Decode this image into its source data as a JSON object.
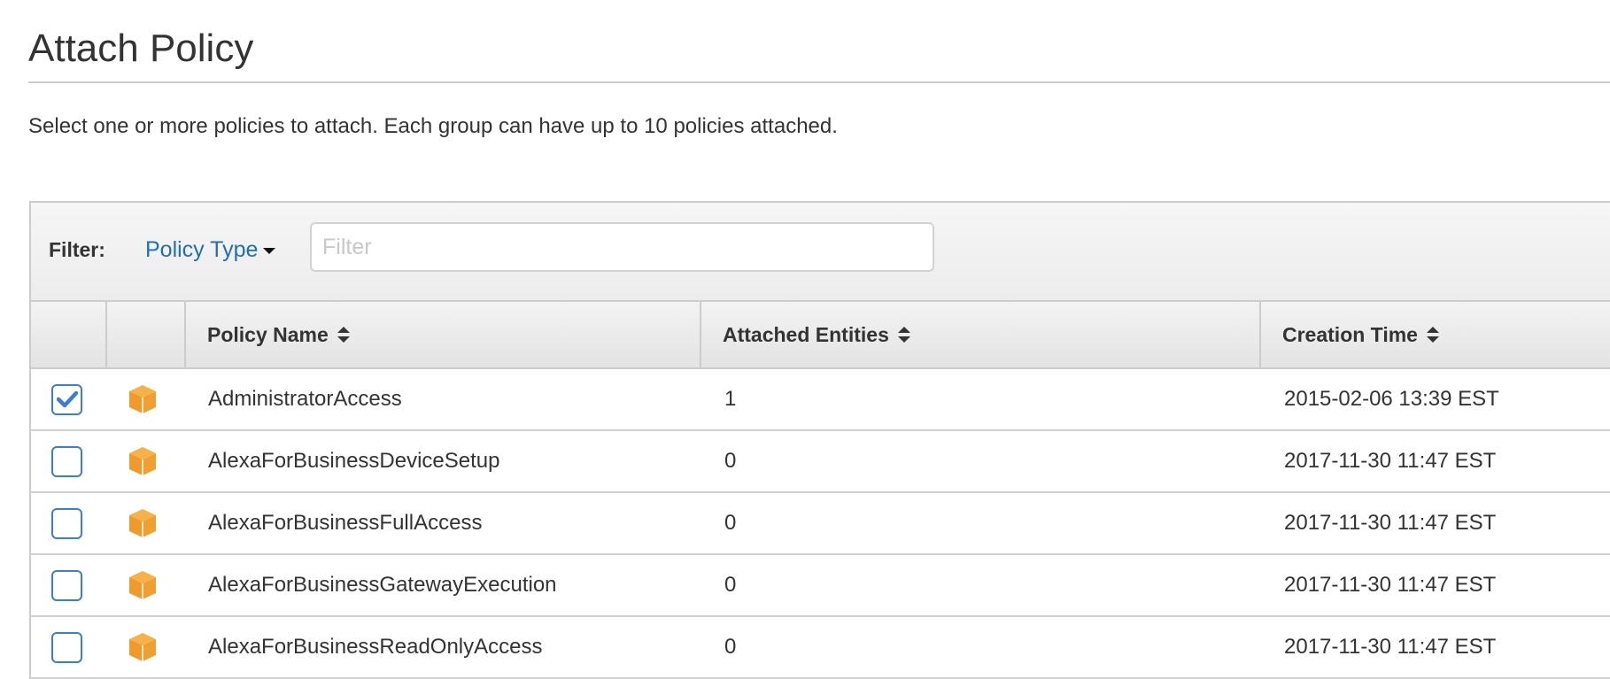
{
  "page": {
    "title": "Attach Policy",
    "subtitle": "Select one or more policies to attach. Each group can have up to 10 policies attached."
  },
  "filter": {
    "label": "Filter:",
    "policy_type_label": "Policy Type",
    "input_value": "",
    "input_placeholder": "Filter"
  },
  "columns": {
    "policy_name": "Policy Name",
    "attached_entities": "Attached Entities",
    "creation_time": "Creation Time"
  },
  "colors": {
    "accent": "#1f6fb8",
    "checkbox": "#3b7fd4",
    "policy_icon": "#f0a030"
  },
  "rows": [
    {
      "checked": true,
      "icon": "aws-managed-policy-cube-icon",
      "name": "AdministratorAccess",
      "entities": "1",
      "created": "2015-02-06 13:39 EST"
    },
    {
      "checked": false,
      "icon": "aws-managed-policy-cube-icon",
      "name": "AlexaForBusinessDeviceSetup",
      "entities": "0",
      "created": "2017-11-30 11:47 EST"
    },
    {
      "checked": false,
      "icon": "aws-managed-policy-cube-icon",
      "name": "AlexaForBusinessFullAccess",
      "entities": "0",
      "created": "2017-11-30 11:47 EST"
    },
    {
      "checked": false,
      "icon": "aws-managed-policy-cube-icon",
      "name": "AlexaForBusinessGatewayExecution",
      "entities": "0",
      "created": "2017-11-30 11:47 EST"
    },
    {
      "checked": false,
      "icon": "aws-managed-policy-cube-icon",
      "name": "AlexaForBusinessReadOnlyAccess",
      "entities": "0",
      "created": "2017-11-30 11:47 EST"
    }
  ]
}
